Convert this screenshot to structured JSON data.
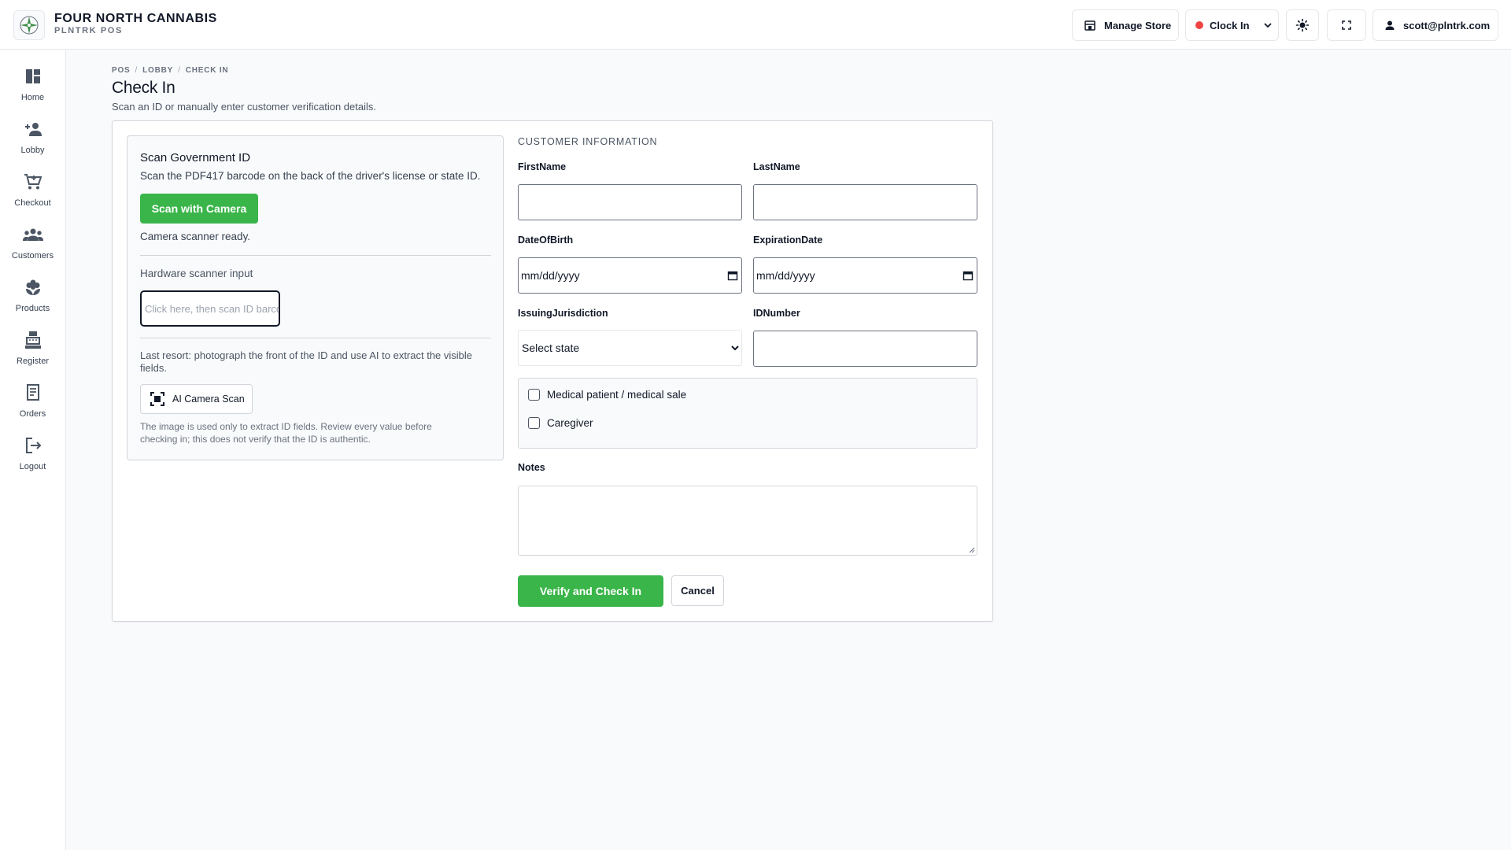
{
  "app": {
    "brand_name": "FOUR NORTH CANNABIS",
    "brand_sub": "PLNTRK POS",
    "colors": {
      "accent": "#3ab54a",
      "clock_dot": "#ef4444"
    }
  },
  "topbar": {
    "manage_store": "Manage Store",
    "clock_in": "Clock In",
    "user_email": "scott@plntrk.com"
  },
  "sidebar": {
    "items": [
      {
        "label": "Home",
        "icon": "dashboard-icon"
      },
      {
        "label": "Lobby",
        "icon": "person-add-icon"
      },
      {
        "label": "Checkout",
        "icon": "cart-icon"
      },
      {
        "label": "Customers",
        "icon": "group-icon"
      },
      {
        "label": "Products",
        "icon": "flower-icon"
      },
      {
        "label": "Register",
        "icon": "register-icon"
      },
      {
        "label": "Orders",
        "icon": "receipt-icon"
      },
      {
        "label": "Logout",
        "icon": "logout-icon"
      }
    ]
  },
  "breadcrumb": [
    "POS",
    "LOBBY",
    "CHECK IN"
  ],
  "page": {
    "title": "Check In",
    "subtitle": "Scan an ID or manually enter customer verification details."
  },
  "scan": {
    "title": "Scan Government ID",
    "description": "Scan the PDF417 barcode on the back of the driver's license or state ID.",
    "camera_button": "Scan with Camera",
    "camera_status": "Camera scanner ready.",
    "hardware_label": "Hardware scanner input",
    "hardware_placeholder": "Click here, then scan ID barcode",
    "last_resort": "Last resort: photograph the front of the ID and use AI to extract the visible fields.",
    "ai_button": "AI Camera Scan",
    "disclaimer": "The image is used only to extract ID fields. Review every value before checking in; this does not verify that the ID is authentic."
  },
  "customer": {
    "section_title": "CUSTOMER INFORMATION",
    "first_name_label": "FirstName",
    "first_name_value": "",
    "last_name_label": "LastName",
    "last_name_value": "",
    "dob_label": "DateOfBirth",
    "dob_value": "mm/dd/yyyy",
    "expiration_label": "ExpirationDate",
    "expiration_value": "mm/dd/yyyy",
    "jurisdiction_label": "IssuingJurisdiction",
    "jurisdiction_value": "Select state",
    "id_number_label": "IDNumber",
    "id_number_value": "",
    "medical_label": "Medical patient / medical sale",
    "caregiver_label": "Caregiver",
    "notes_label": "Notes",
    "notes_value": ""
  },
  "actions": {
    "verify": "Verify and Check In",
    "cancel": "Cancel"
  }
}
